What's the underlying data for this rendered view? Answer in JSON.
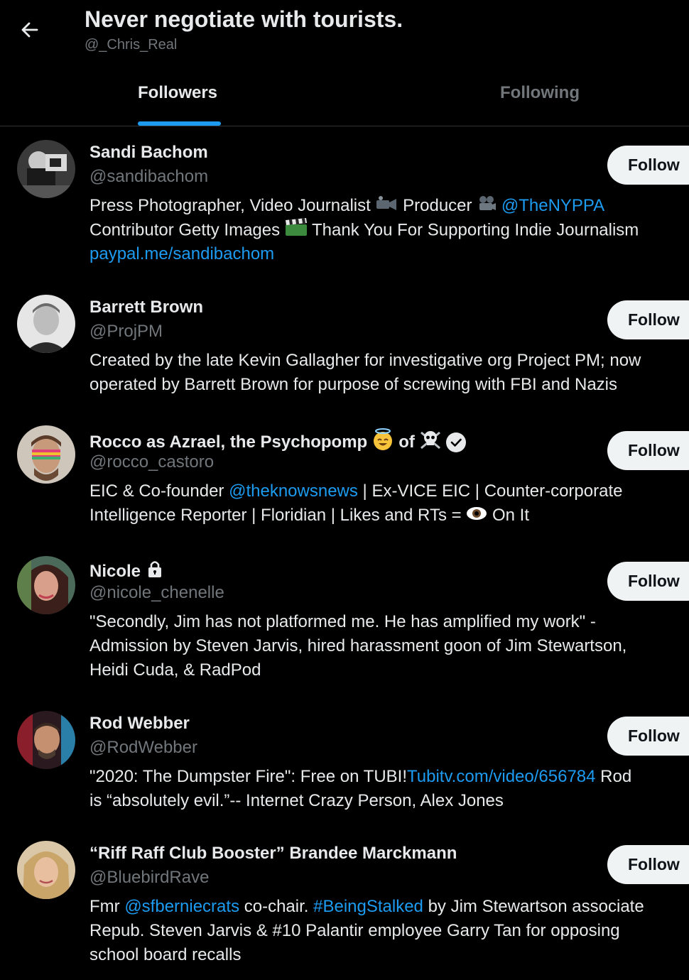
{
  "header": {
    "title": "Never negotiate with tourists.",
    "handle": "@_Chris_Real"
  },
  "tabs": [
    {
      "label": "Followers",
      "active": true
    },
    {
      "label": "Following",
      "active": false
    }
  ],
  "follow_label": "Follow",
  "accent_color": "#1d9bf0",
  "users": [
    {
      "name": "Sandi Bachom",
      "handle": "@sandibachom",
      "bio_l1_a": "Press Photographer, Video Journalist ",
      "bio_l1_b": " Producer ",
      "bio_l1_link": "@TheNYPPA",
      "bio_l2_a": "Contributor Getty Images ",
      "bio_l2_b": " Thank You For Supporting Indie Journalism",
      "bio_l3_link": "paypal.me/sandibachom"
    },
    {
      "name": "Barrett Brown",
      "handle": "@ProjPM",
      "bio_l1": "Created by the late Kevin Gallagher for investigative org Project PM; now",
      "bio_l2": "operated by Barrett Brown for purpose of screwing with FBI and Nazis"
    },
    {
      "name_a": "Rocco as Azrael, the Psychopomp",
      "name_b": "of",
      "handle": "@rocco_castoro",
      "bio_l1_a": "EIC & Co-founder ",
      "bio_l1_link": "@theknowsnews",
      "bio_l1_b": " | Ex-VICE EIC | Counter-corporate",
      "bio_l2_a": "Intelligence Reporter | Floridian | Likes and RTs = ",
      "bio_l2_b": " On It"
    },
    {
      "name": "Nicole",
      "handle": "@nicole_chenelle",
      "bio_l1": "\"Secondly, Jim has not platformed me. He has amplified my work\" -",
      "bio_l2": "Admission by Steven Jarvis, hired harassment goon of Jim Stewartson,",
      "bio_l3": "Heidi Cuda, & RadPod"
    },
    {
      "name": "Rod Webber",
      "handle": "@RodWebber",
      "bio_l1_a": "\"2020: The Dumpster Fire\": Free on TUBI!",
      "bio_l1_link": "Tubitv.com/video/656784",
      "bio_l1_b": " Rod",
      "bio_l2": "is “absolutely evil.”-- Internet Crazy Person, Alex Jones"
    },
    {
      "name": "“Riff Raff Club Booster” Brandee Marckmann",
      "handle": "@BluebirdRave",
      "bio_l1_a": "Fmr ",
      "bio_l1_link1": "@sfberniecrats",
      "bio_l1_b": " co-chair. ",
      "bio_l1_link2": "#BeingStalked",
      "bio_l1_c": " by Jim Stewartson associate",
      "bio_l2": "Repub. Steven Jarvis & #10 Palantir employee Garry Tan for opposing",
      "bio_l3": "school board recalls"
    }
  ]
}
